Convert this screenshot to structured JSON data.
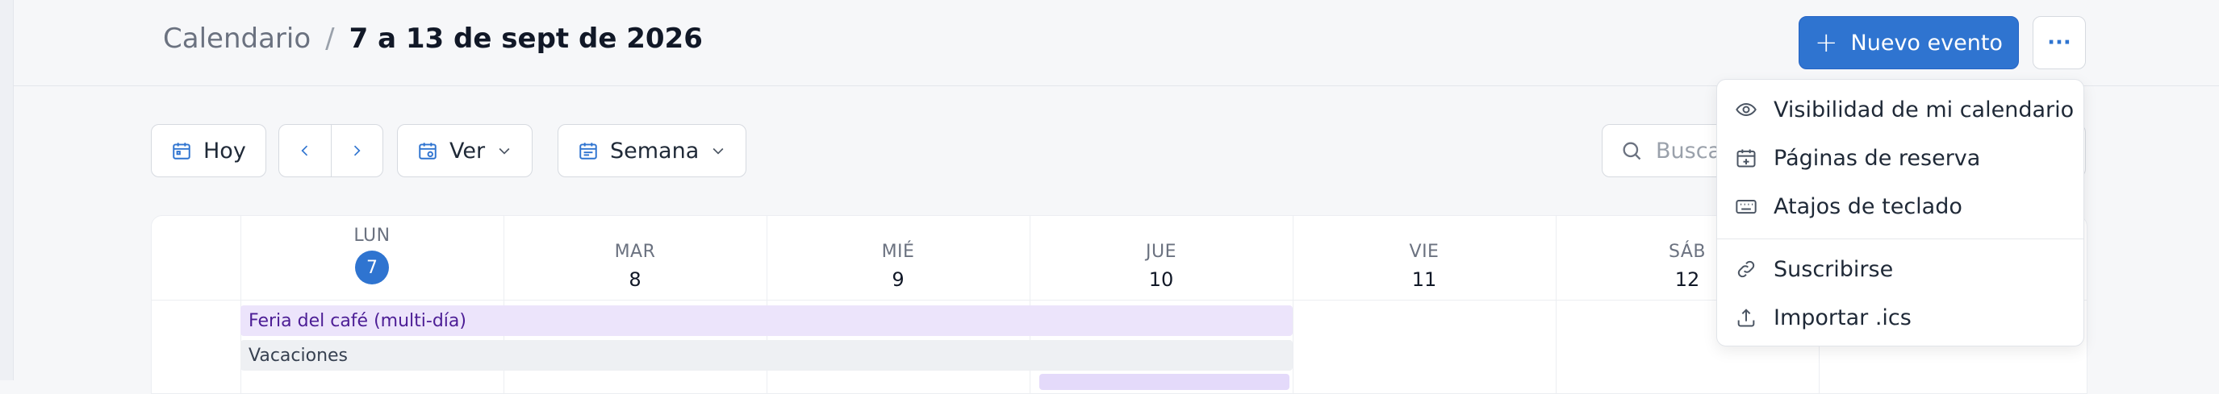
{
  "breadcrumb": {
    "section": "Calendario",
    "separator": "/",
    "range": "7 a 13 de sept de 2026"
  },
  "header": {
    "new_event_label": "Nuevo evento",
    "more_label": "···"
  },
  "toolbar": {
    "today_label": "Hoy",
    "view_label": "Ver",
    "range_label": "Semana",
    "search_placeholder": "Buscar"
  },
  "days": [
    {
      "name": "LUN",
      "num": "7",
      "today": true
    },
    {
      "name": "MAR",
      "num": "8"
    },
    {
      "name": "MIÉ",
      "num": "9"
    },
    {
      "name": "JUE",
      "num": "10"
    },
    {
      "name": "VIE",
      "num": "11"
    },
    {
      "name": "SÁB",
      "num": "12"
    }
  ],
  "events": {
    "multi_day": "Feria del café (multi-día)",
    "vacation": "Vacaciones"
  },
  "menu": {
    "items": [
      {
        "label": "Visibilidad de mi calendario",
        "icon": "eye-icon"
      },
      {
        "label": "Páginas de reserva",
        "icon": "calendar-plus-icon"
      },
      {
        "label": "Atajos de teclado",
        "icon": "keyboard-icon"
      },
      {
        "label": "Suscribirse",
        "icon": "link-icon"
      },
      {
        "label": "Importar .ics",
        "icon": "upload-icon"
      }
    ]
  },
  "colors": {
    "accent": "#2f74d0",
    "event_purple": "#ece4fb",
    "event_gray": "#eef0f3"
  }
}
